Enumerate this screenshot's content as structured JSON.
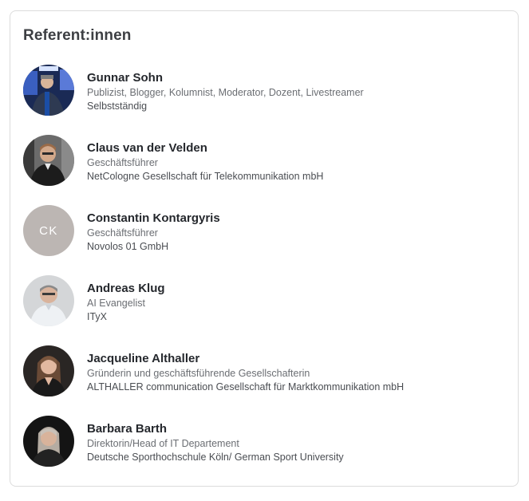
{
  "section": {
    "title": "Referent:innen"
  },
  "speakers": [
    {
      "name": "Gunnar Sohn",
      "role": "Publizist, Blogger, Kolumnist, Moderator, Dozent, Livestreamer",
      "company": "Selbstständig",
      "avatar": "photo"
    },
    {
      "name": "Claus van der Velden",
      "role": "Geschäftsführer",
      "company": "NetCologne Gesellschaft für Telekommunikation mbH",
      "avatar": "photo"
    },
    {
      "name": "Constantin Kontargyris",
      "role": "Geschäftsführer",
      "company": "Novolos 01 GmbH",
      "avatar": "initials",
      "initials": "CK",
      "initials_bg": "#bcb6b3"
    },
    {
      "name": "Andreas Klug",
      "role": "AI Evangelist",
      "company": "ITyX",
      "avatar": "photo"
    },
    {
      "name": "Jacqueline Althaller",
      "role": "Gründerin und geschäftsführende Gesellschafterin",
      "company": "ALTHALLER communication Gesellschaft für Marktkommunikation mbH",
      "avatar": "photo"
    },
    {
      "name": "Barbara Barth",
      "role": "Direktorin/Head of IT Departement",
      "company": "Deutsche Sporthochschule Köln/ German Sport University",
      "avatar": "photo"
    }
  ]
}
